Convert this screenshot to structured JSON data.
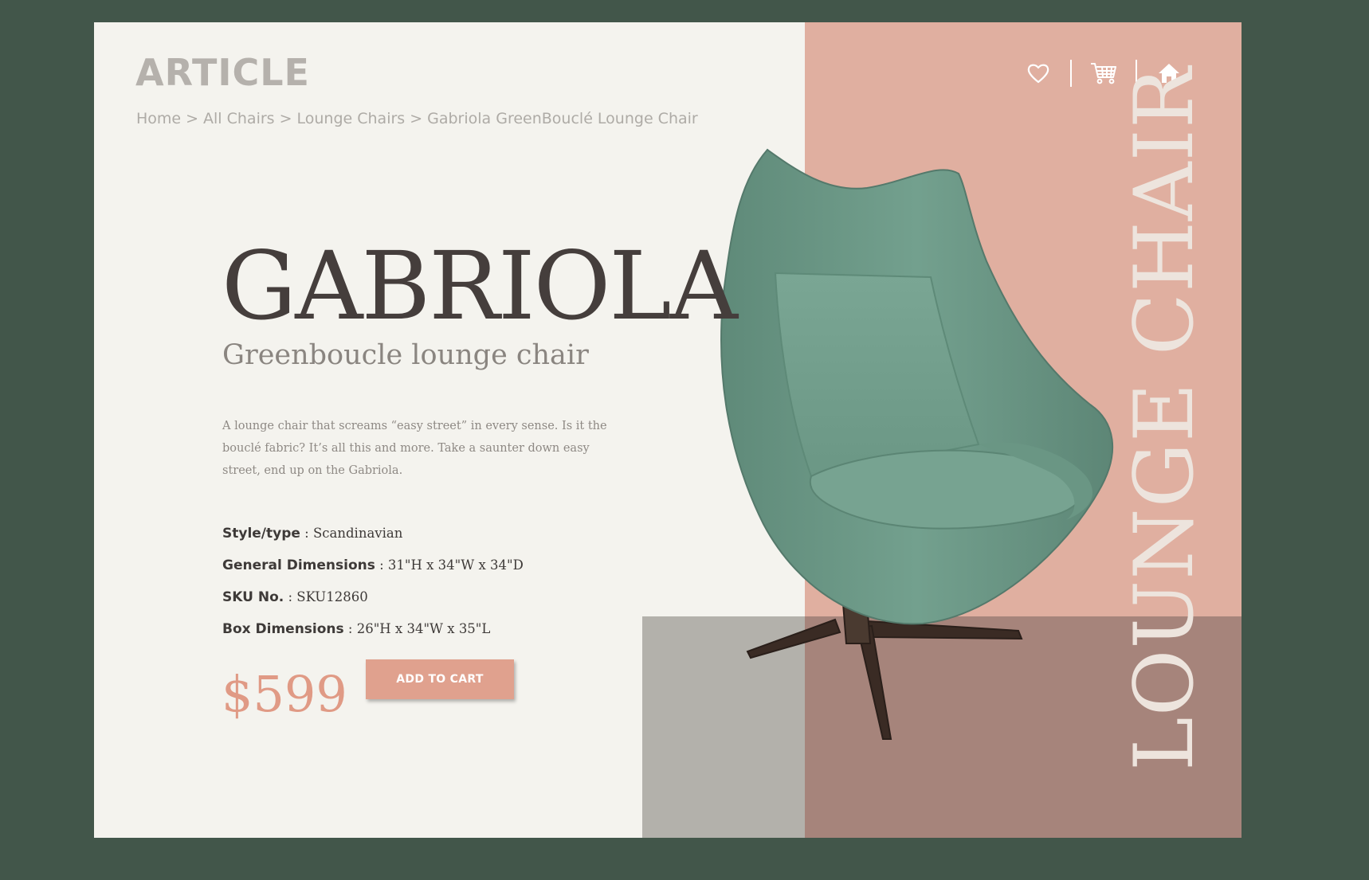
{
  "brand": {
    "logo": "ARTICLE"
  },
  "breadcrumb": {
    "separator": ">",
    "items": [
      "Home",
      "All Chairs",
      "Lounge Chairs",
      "Gabriola GreenBouclé Lounge Chair"
    ]
  },
  "header_icons": [
    "heart-icon",
    "cart-icon",
    "home-icon"
  ],
  "category_vertical": "LOUNGE CHAIR",
  "product": {
    "name": "GABRIOLA",
    "subtitle": "Greenboucle lounge chair",
    "description": "A lounge chair that screams “easy street” in every sense. Is it the bouclé fabric? It’s all this and more. Take a saunter down easy street, end up on the Gabriola.",
    "specs": [
      {
        "label": "Style/type",
        "value": " : Scandinavian"
      },
      {
        "label": "General Dimensions",
        "value": " : 31\"H x 34\"W x 34\"D"
      },
      {
        "label": "SKU No.",
        "value": " : SKU12860"
      },
      {
        "label": "Box Dimensions",
        "value": " : 26\"H x 34\"W x 35\"L"
      }
    ],
    "price": "$599",
    "cta": "ADD TO CART"
  },
  "colors": {
    "page_background": "#42564a",
    "card": "#f4f3ee",
    "pink_panel": "#e0afa0",
    "mauve_panel": "#a6847b",
    "grey_panel": "#b3b1ab",
    "accent": "#e09a85",
    "chair_green": "#6e9a88"
  }
}
